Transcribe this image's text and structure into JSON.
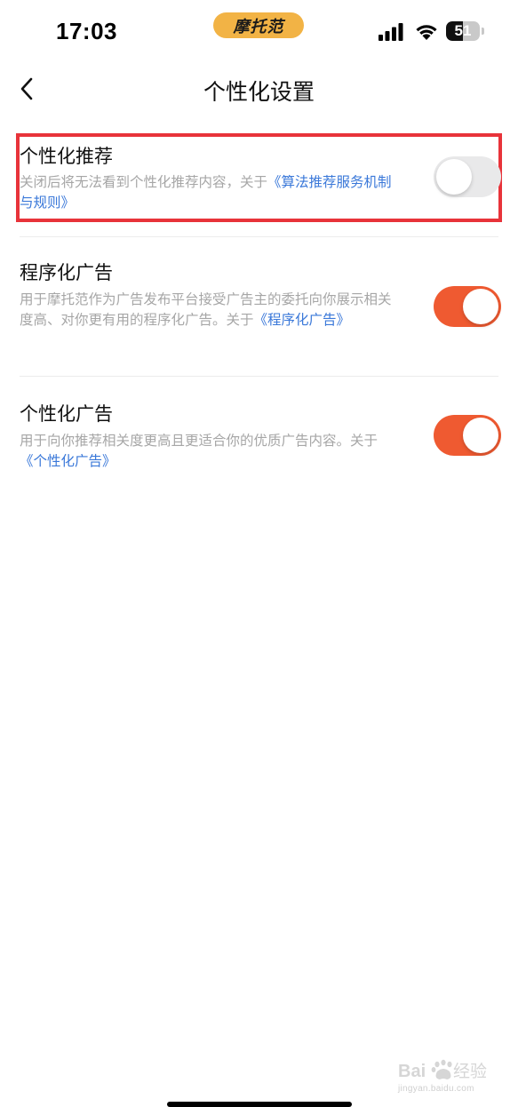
{
  "status_bar": {
    "time": "17:03",
    "app_badge": "摩托范",
    "battery": "51",
    "battery_level": 0.51
  },
  "nav": {
    "title": "个性化设置",
    "back_icon": "chevron-left-icon"
  },
  "settings": [
    {
      "title": "个性化推荐",
      "desc_text": "关闭后将无法看到个性化推荐内容，关于",
      "link_text": "《算法推荐服务机制与规则》",
      "enabled": false,
      "highlighted": true
    },
    {
      "title": "程序化广告",
      "desc_text": "用于摩托范作为广告发布平台接受广告主的委托向你展示相关度高、对你更有用的程序化广告。关于",
      "link_text": "《程序化广告》",
      "enabled": true,
      "highlighted": false
    },
    {
      "title": "个性化广告",
      "desc_text": "用于向你推荐相关度更高且更适合你的优质广告内容。关于",
      "link_text": "《个性化广告》",
      "enabled": true,
      "highlighted": false
    }
  ],
  "watermark": {
    "logo": "Baidu 经验",
    "url": "jingyan.baidu.com"
  },
  "colors": {
    "toggle_on": "#ef5a31",
    "toggle_off": "#e9e9ea",
    "link": "#3a78d9",
    "highlight": "#e8333a",
    "badge": "#f2b345"
  }
}
